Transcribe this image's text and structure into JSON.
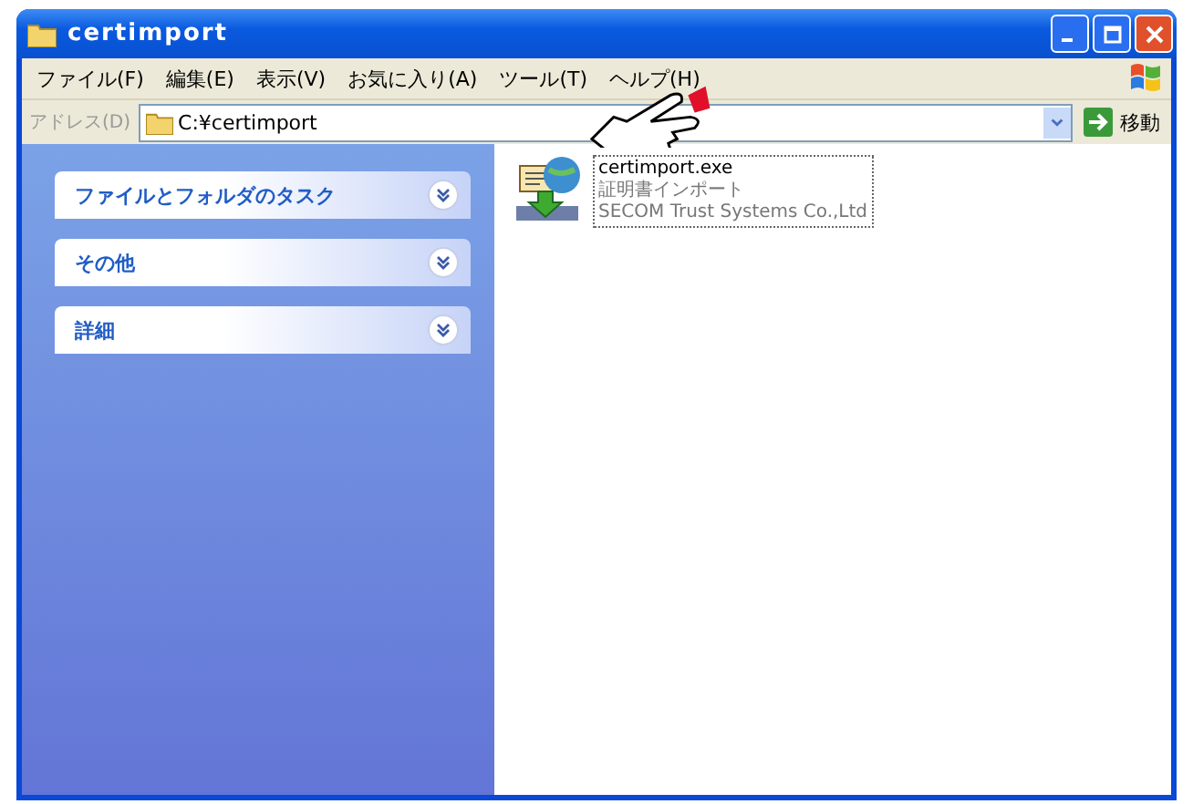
{
  "window": {
    "title": "certimport"
  },
  "menu": [
    "ファイル(F)",
    "編集(E)",
    "表示(V)",
    "お気に入り(A)",
    "ツール(T)",
    "ヘルプ(H)"
  ],
  "address_bar": {
    "label": "アドレス(D)",
    "value": "C:¥certimport",
    "go_button": "移動"
  },
  "task_panels": [
    {
      "title": "ファイルとフォルダのタスク",
      "expanded": false
    },
    {
      "title": "その他",
      "expanded": false
    },
    {
      "title": "詳細",
      "expanded": false
    }
  ],
  "files": [
    {
      "name": "certimport.exe",
      "description": "証明書インポート",
      "company": "SECOM Trust Systems Co.,Ltd",
      "selected": true
    }
  ]
}
